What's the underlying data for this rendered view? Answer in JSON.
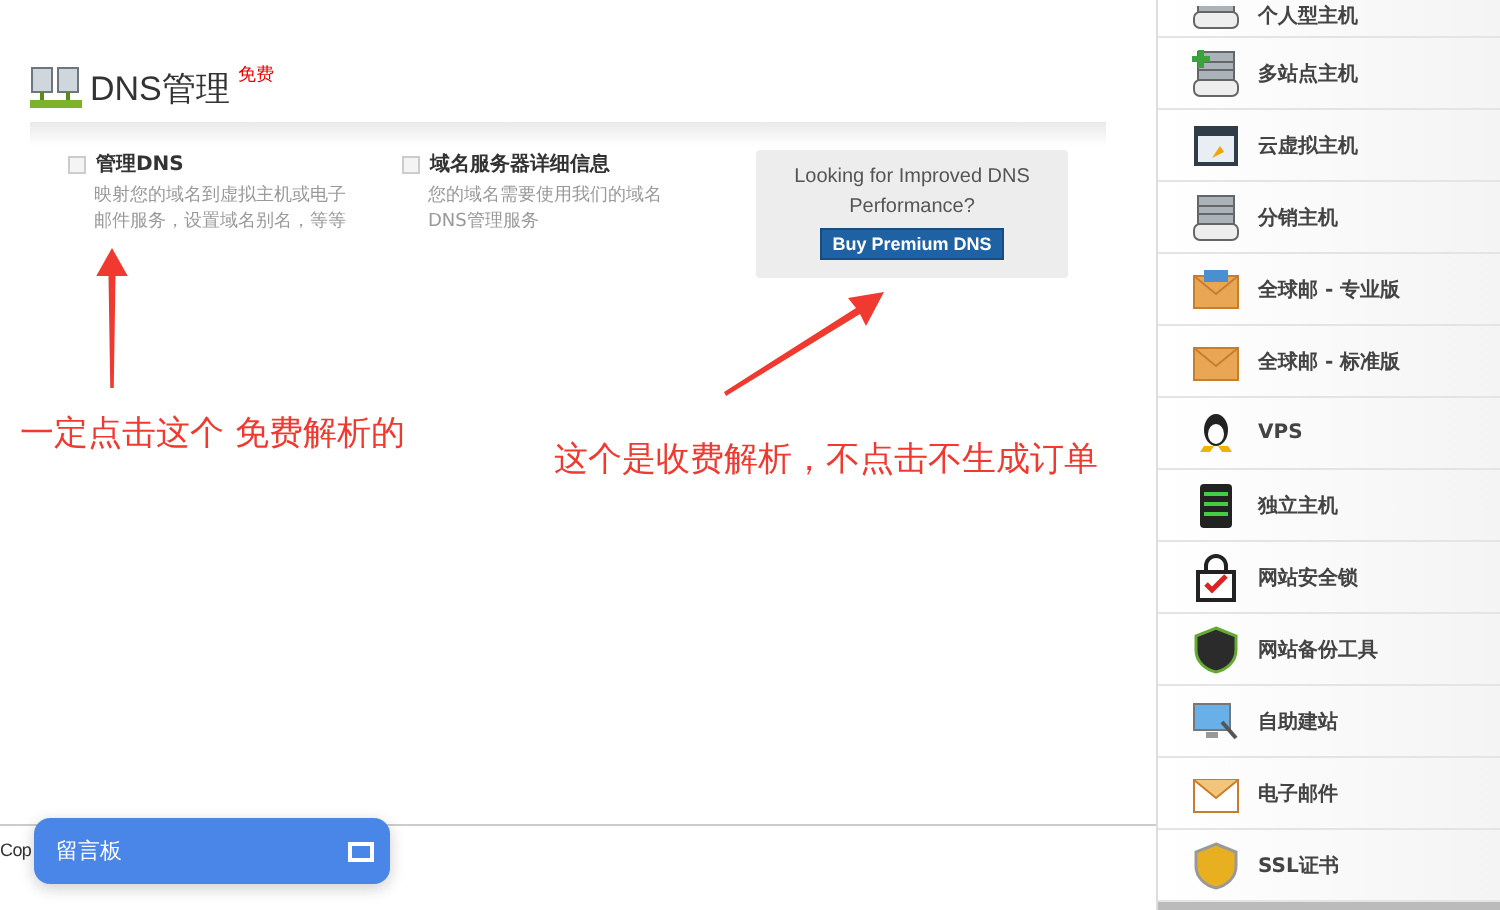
{
  "header": {
    "title": "DNS管理",
    "badge": "免费"
  },
  "options": [
    {
      "title": "管理DNS",
      "description": "映射您的域名到虚拟主机或电子邮件服务，设置域名别名，等等"
    },
    {
      "title": "域名服务器详细信息",
      "description": "您的域名需要使用我们的域名DNS管理服务"
    }
  ],
  "promo": {
    "text": "Looking for Improved DNS Performance?",
    "button": "Buy Premium DNS"
  },
  "annotations": [
    {
      "text": "一定点击这个 免费解析的"
    },
    {
      "text": "这个是收费解析，不点击不生成订单"
    }
  ],
  "footer": {
    "text": "Cop"
  },
  "chat_widget": {
    "title": "留言板"
  },
  "sidebar": {
    "items": [
      {
        "label": "个人型主机",
        "kind": "sdh"
      },
      {
        "label": "多站点主机",
        "kind": "mdh"
      },
      {
        "label": "云虚拟主机",
        "kind": "cloud"
      },
      {
        "label": "分销主机",
        "kind": "rh"
      },
      {
        "label": "全球邮 - 专业版",
        "kind": "mailpro"
      },
      {
        "label": "全球邮 - 标准版",
        "kind": "mail"
      },
      {
        "label": "VPS",
        "kind": "vps"
      },
      {
        "label": "独立主机",
        "kind": "server"
      },
      {
        "label": "网站安全锁",
        "kind": "lock"
      },
      {
        "label": "网站备份工具",
        "kind": "backup"
      },
      {
        "label": "自助建站",
        "kind": "builder"
      },
      {
        "label": "电子邮件",
        "kind": "email"
      },
      {
        "label": "SSL证书",
        "kind": "ssl"
      }
    ]
  }
}
